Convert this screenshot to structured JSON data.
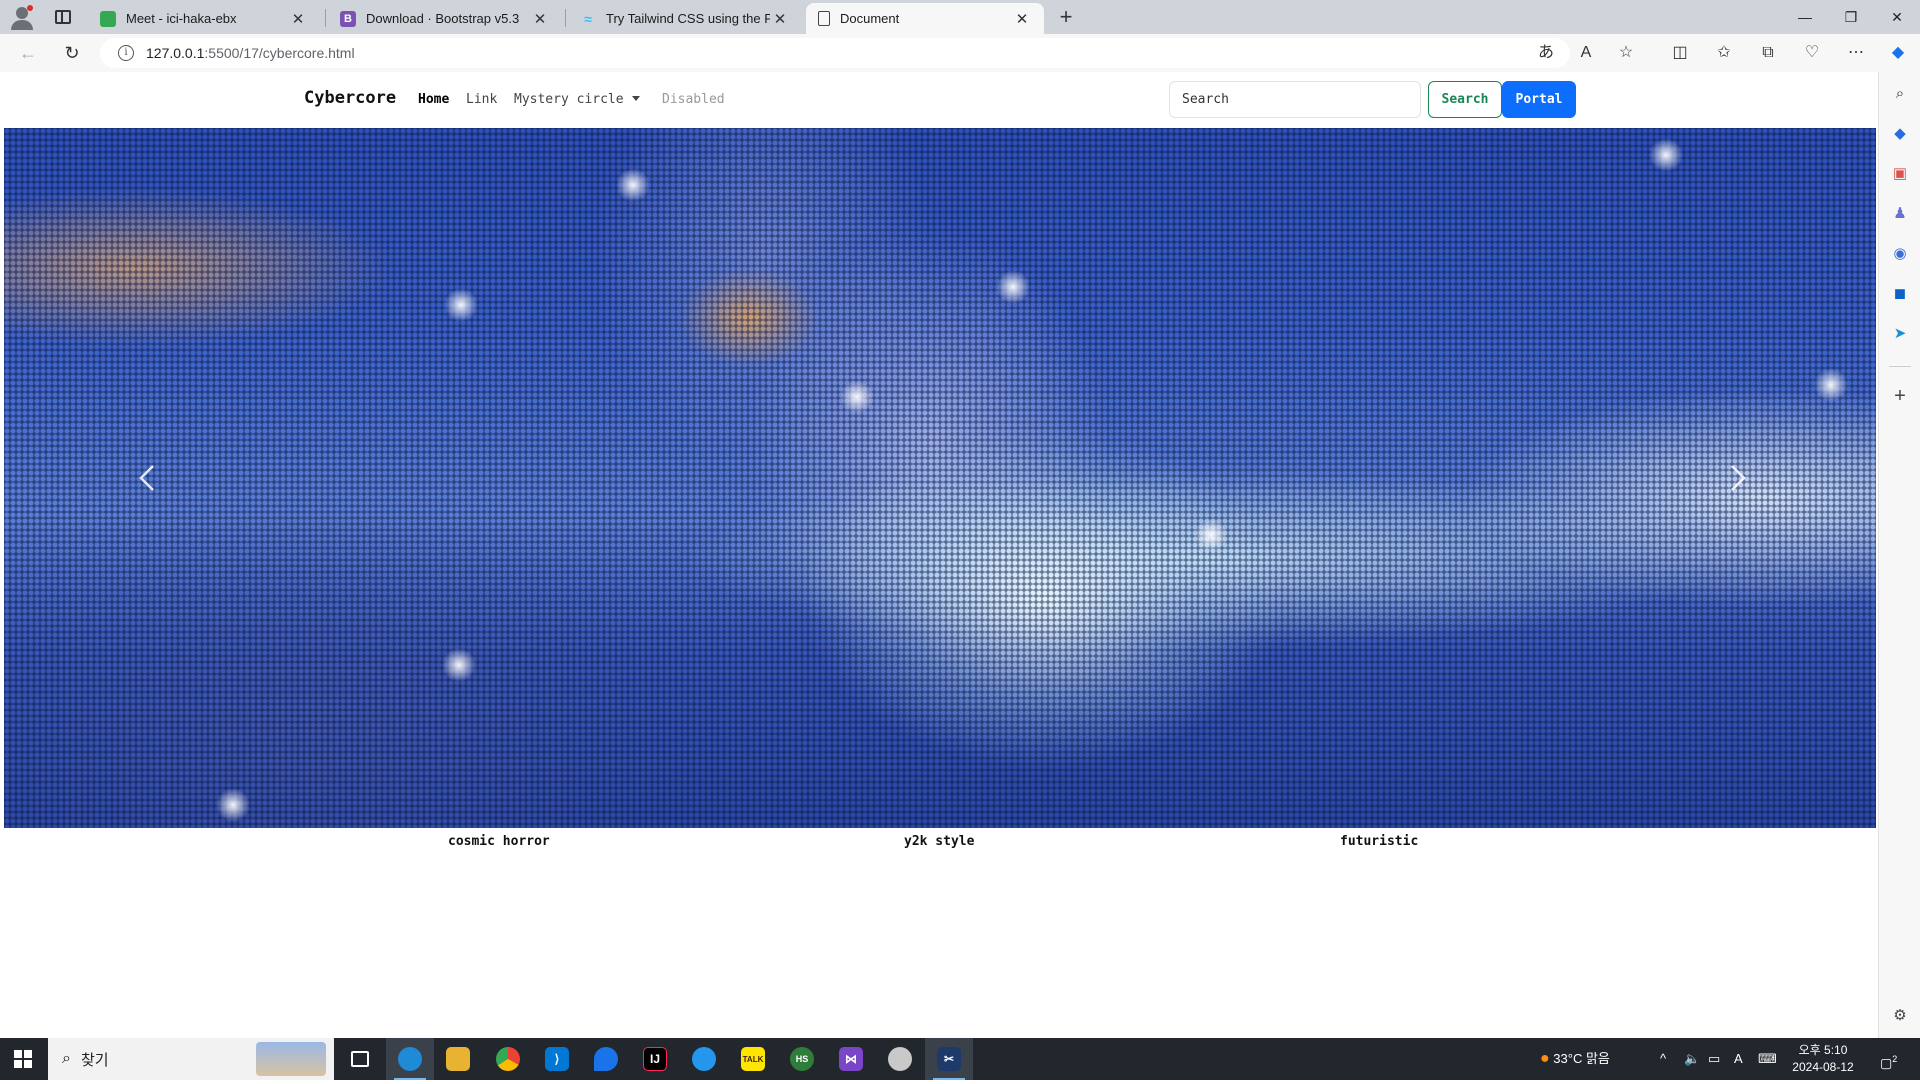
{
  "browser": {
    "tabs": [
      {
        "title": "Meet - ici-haka-ebx",
        "favicon_color": "#34a853"
      },
      {
        "title": "Download · Bootstrap v5.3",
        "favicon_color": "#7952b3",
        "favicon_letter": "B"
      },
      {
        "title": "Try Tailwind CSS using the Play C",
        "favicon_color": "#38bdf8"
      },
      {
        "title": "Document",
        "favicon_color": "#ffffff"
      }
    ],
    "url_host": "127.0.0.1",
    "url_path": ":5500/17/cybercore.html",
    "window_controls": [
      "minimize",
      "restore",
      "close"
    ]
  },
  "navbar": {
    "brand": "Cybercore",
    "links": [
      {
        "label": "Home",
        "state": "active"
      },
      {
        "label": "Link",
        "state": "normal"
      },
      {
        "label": "Mystery circle",
        "state": "dropdown"
      },
      {
        "label": "Disabled",
        "state": "disabled"
      }
    ],
    "search_placeholder": "Search",
    "search_button": "Search",
    "portal_button": "Portal"
  },
  "carousel": {
    "captions": [
      "cosmic horror",
      "y2k style",
      "futuristic"
    ],
    "prev_icon": "chevron-left-icon",
    "next_icon": "chevron-right-icon"
  },
  "taskbar": {
    "search_text": "찾기",
    "weather": "33°C 맑음",
    "time": "오후 5:10",
    "date": "2024-08-12",
    "notification_count": "2",
    "ime": "A"
  },
  "colors": {
    "primary": "#0d6efd",
    "success": "#198754"
  }
}
